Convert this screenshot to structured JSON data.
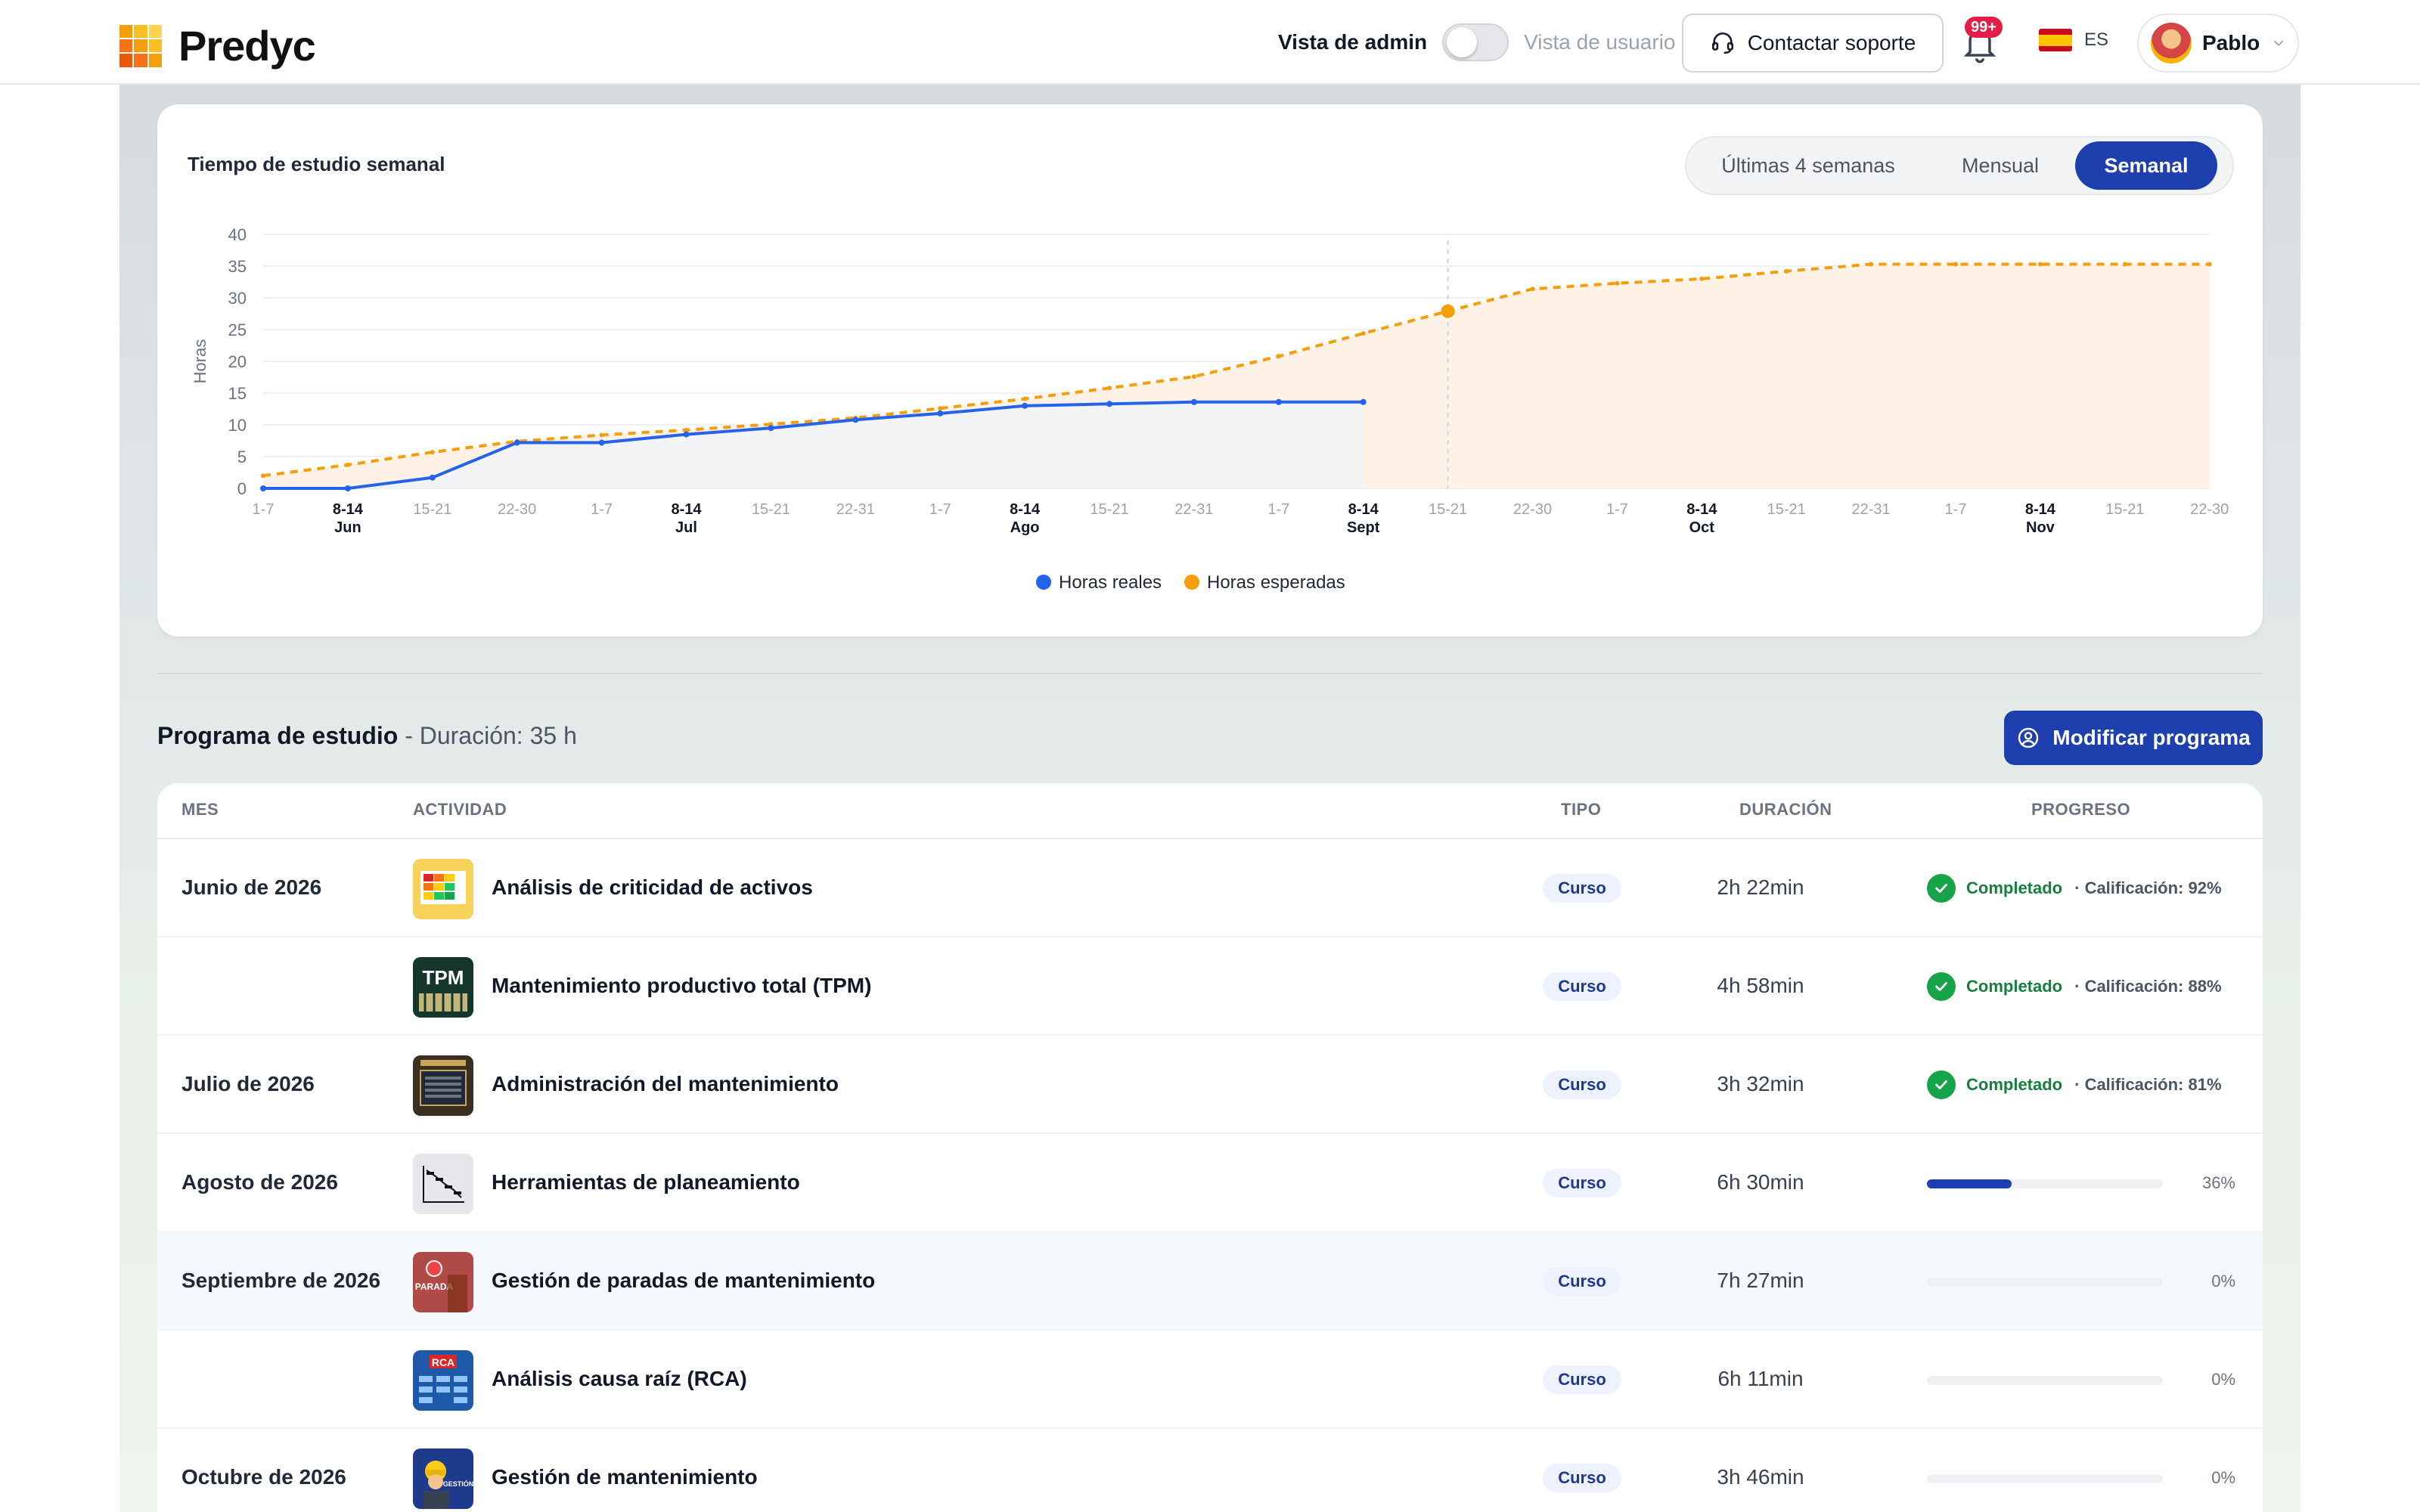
{
  "app": {
    "name": "Predyc"
  },
  "header": {
    "admin_view_label": "Vista de admin",
    "user_view_label": "Vista de usuario",
    "support_label": "Contactar soporte",
    "notifications_badge": "99+",
    "language": "ES",
    "user_name": "Pablo"
  },
  "colors": {
    "primary": "#1e40af",
    "actual": "#2563eb",
    "expected": "#f59e0b",
    "completed": "#16a34a"
  },
  "chart": {
    "title": "Tiempo de estudio semanal",
    "segments": [
      "Últimas 4 semanas",
      "Mensual",
      "Semanal"
    ],
    "active_segment": "Semanal"
  },
  "chart_data": {
    "type": "line",
    "title": "Tiempo de estudio semanal",
    "ylabel": "Horas",
    "ylim": [
      0,
      40
    ],
    "yticks": [
      0,
      5,
      10,
      15,
      20,
      25,
      30,
      35,
      40
    ],
    "x_labels": [
      "1-7",
      "8-14",
      "15-21",
      "22-30",
      "1-7",
      "8-14",
      "15-21",
      "22-31",
      "1-7",
      "8-14",
      "15-21",
      "22-31",
      "1-7",
      "8-14",
      "15-21",
      "22-30",
      "1-7",
      "8-14",
      "15-21",
      "22-31",
      "1-7",
      "8-14",
      "15-21",
      "22-30"
    ],
    "month_labels": [
      "Jun",
      "Jul",
      "Ago",
      "Sept",
      "Oct",
      "Nov"
    ],
    "legend": [
      "Horas reales",
      "Horas esperadas"
    ],
    "legend_position": "bottom-center",
    "series": [
      {
        "name": "Horas reales",
        "values": [
          0,
          0,
          1.7,
          7.2,
          7.2,
          8.5,
          9.5,
          10.8,
          11.8,
          13,
          13.3,
          13.6,
          13.6,
          13.6
        ]
      },
      {
        "name": "Horas esperadas",
        "values": [
          2,
          3.7,
          5.7,
          7.4,
          8.4,
          9.2,
          10.1,
          11.1,
          12.6,
          14.1,
          15.8,
          17.6,
          20.8,
          24.4,
          27.9,
          31.4,
          32.3,
          33.0,
          34.2,
          35.3,
          35.3,
          35.3,
          35.3,
          35.3
        ]
      }
    ],
    "current_week": "15-21"
  },
  "program": {
    "title": "Programa de estudio",
    "duration": "- Duración: 35 h",
    "modify_label": "Modificar programa",
    "columns": [
      "MES",
      "ACTIVIDAD",
      "TIPO",
      "DURACIÓN",
      "PROGRESO"
    ],
    "rows": [
      {
        "month": "Junio de 2026",
        "activity": "Análisis de criticidad de activos",
        "type": "Curso",
        "duration": "2h 22min",
        "status": "Completado",
        "grade": "· Calificación: 92%"
      },
      {
        "month": "",
        "activity": "Mantenimiento productivo total (TPM)",
        "type": "Curso",
        "duration": "4h 58min",
        "status": "Completado",
        "grade": "· Calificación: 88%",
        "thumb_text": "TPM"
      },
      {
        "month": "Julio de 2026",
        "activity": "Administración del mantenimiento",
        "type": "Curso",
        "duration": "3h 32min",
        "status": "Completado",
        "grade": "· Calificación: 81%"
      },
      {
        "month": "Agosto de 2026",
        "activity": "Herramientas de planeamiento",
        "type": "Curso",
        "duration": "6h 30min",
        "progress": 36,
        "progress_label": "36%"
      },
      {
        "month": "Septiembre de 2026",
        "activity": "Gestión de paradas de mantenimiento",
        "type": "Curso",
        "duration": "7h 27min",
        "progress": 0,
        "progress_label": "0%"
      },
      {
        "month": "",
        "activity": "Análisis causa raíz (RCA)",
        "type": "Curso",
        "duration": "6h 11min",
        "progress": 0,
        "progress_label": "0%",
        "thumb_text": "RCA"
      },
      {
        "month": "Octubre de 2026",
        "activity": "Gestión de mantenimiento",
        "type": "Curso",
        "duration": "3h 46min",
        "progress": 0,
        "progress_label": "0%"
      }
    ]
  }
}
